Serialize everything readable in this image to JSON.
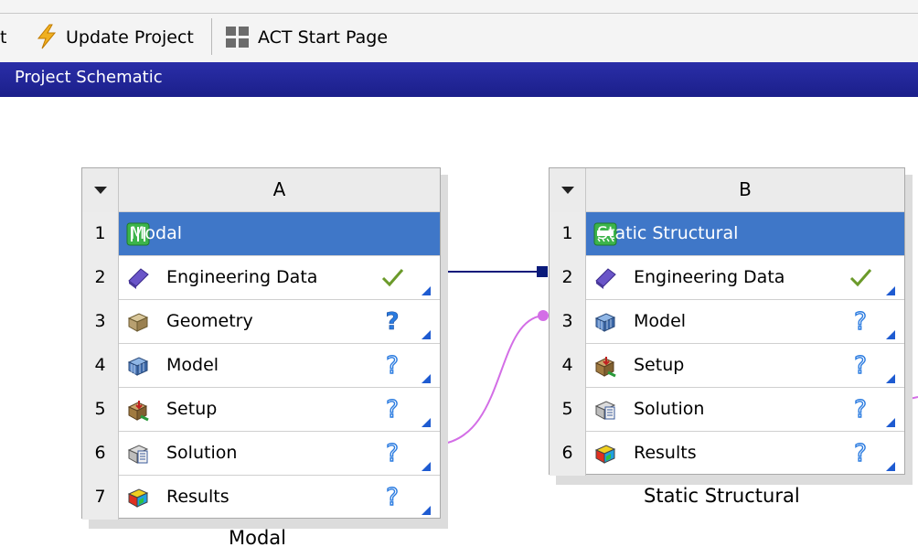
{
  "toolbar": {
    "partial_label": "t",
    "update_label": "Update Project",
    "act_label": "ACT Start Page"
  },
  "header": {
    "title": "Project Schematic"
  },
  "system_a": {
    "column": "A",
    "caption": "Modal",
    "rows": [
      {
        "num": "1",
        "label": "Modal",
        "icon": "modal-icon",
        "status": ""
      },
      {
        "num": "2",
        "label": "Engineering Data",
        "icon": "engineering-data-icon",
        "status": "check"
      },
      {
        "num": "3",
        "label": "Geometry",
        "icon": "geometry-icon",
        "status": "question"
      },
      {
        "num": "4",
        "label": "Model",
        "icon": "model-icon",
        "status": "question-outline"
      },
      {
        "num": "5",
        "label": "Setup",
        "icon": "setup-icon",
        "status": "question-outline"
      },
      {
        "num": "6",
        "label": "Solution",
        "icon": "solution-icon",
        "status": "question-outline"
      },
      {
        "num": "7",
        "label": "Results",
        "icon": "results-icon",
        "status": "question-outline"
      }
    ]
  },
  "system_b": {
    "column": "B",
    "caption": "Static Structural",
    "rows": [
      {
        "num": "1",
        "label": "Static Structural",
        "icon": "static-structural-icon",
        "status": ""
      },
      {
        "num": "2",
        "label": "Engineering Data",
        "icon": "engineering-data-icon",
        "status": "check"
      },
      {
        "num": "3",
        "label": "Model",
        "icon": "model-icon",
        "status": "question-outline"
      },
      {
        "num": "4",
        "label": "Setup",
        "icon": "setup-icon",
        "status": "question-outline"
      },
      {
        "num": "5",
        "label": "Solution",
        "icon": "solution-icon",
        "status": "question-outline"
      },
      {
        "num": "6",
        "label": "Results",
        "icon": "results-icon",
        "status": "question-outline"
      }
    ]
  },
  "colors": {
    "header_bg": "#1b1f8a",
    "title_row_bg": "#3f77c8",
    "link_share": "#0a1a7a",
    "link_transfer": "#d36ee6",
    "check": "#6b9a2a"
  }
}
